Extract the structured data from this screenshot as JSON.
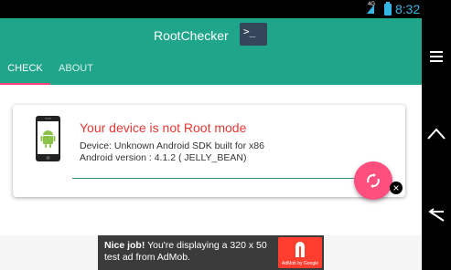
{
  "status_bar": {
    "time": "8:32",
    "network": "4G"
  },
  "app_bar": {
    "title": "RootChecker",
    "terminal_label": ">_"
  },
  "tabs": [
    {
      "label": "CHECK",
      "active": true
    },
    {
      "label": "ABOUT",
      "active": false
    }
  ],
  "card": {
    "status_title": "Your device is not Root mode",
    "device_line": "Device: Unknown Android SDK built for x86",
    "android_version_line": "Android version : 4.1.2 ( JELLY_BEAN)"
  },
  "ad": {
    "headline": "Nice job!",
    "body": " You're displaying a 320 x 50 test ad from AdMob.",
    "badge": "AdMob by Google"
  },
  "colors": {
    "primary": "#1ea58a",
    "accent": "#ff4f7f",
    "tab_indicator": "#ff4081",
    "error_text": "#e53935",
    "status_icons": "#33b5e5"
  },
  "icons": {
    "terminal": "terminal-icon",
    "refresh_fab": "refresh-icon",
    "ad_close": "close-icon",
    "nav_menu": "menu-icon",
    "nav_home": "home-icon",
    "nav_back": "back-icon"
  }
}
